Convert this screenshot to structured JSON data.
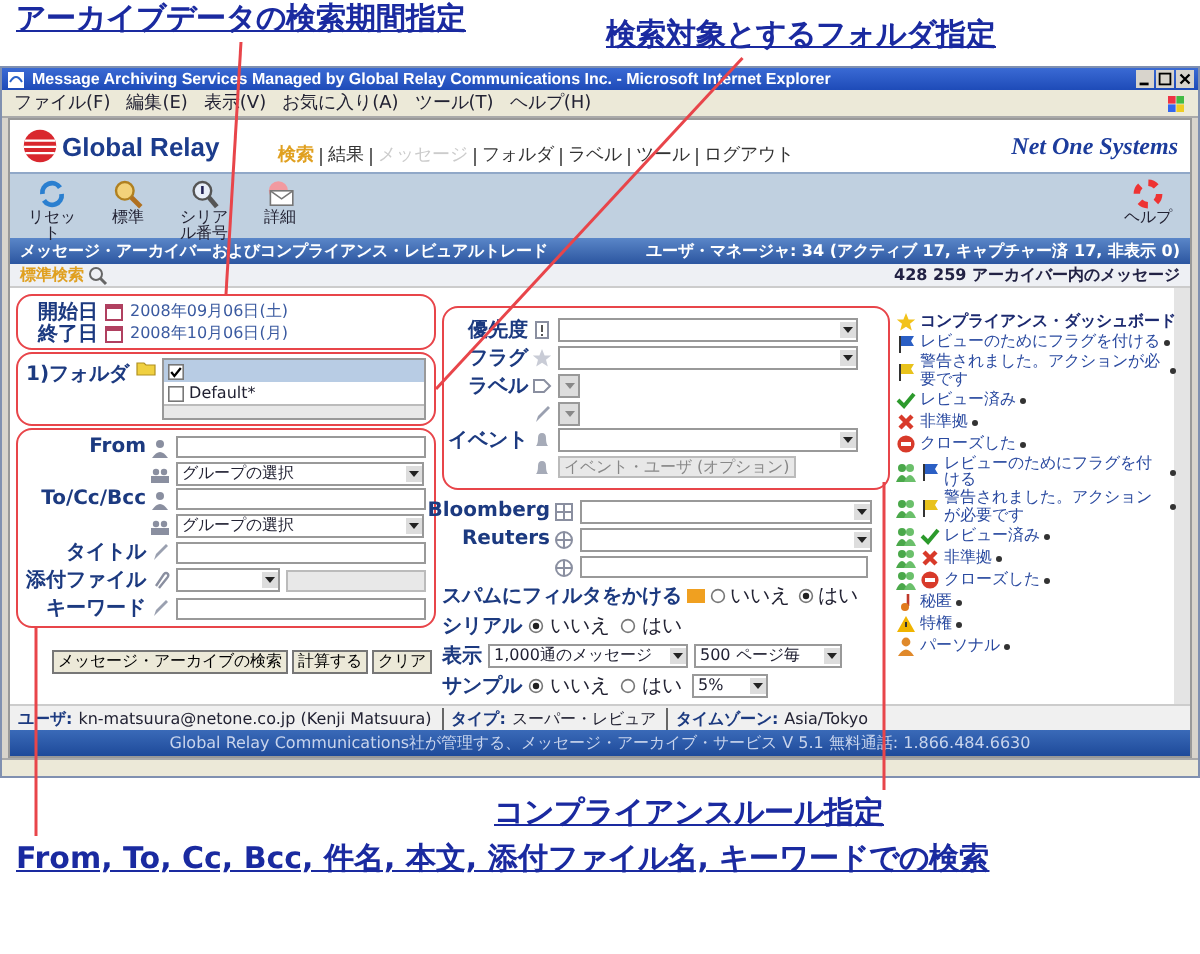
{
  "callouts_top": [
    "アーカイブデータの検索期間指定",
    "検索対象とするフォルダ指定"
  ],
  "window": {
    "title": "Message Archiving Services Managed by Global Relay Communications Inc. - Microsoft Internet Explorer",
    "menu": [
      "ファイル(F)",
      "編集(E)",
      "表示(V)",
      "お気に入り(A)",
      "ツール(T)",
      "ヘルプ(H)"
    ]
  },
  "header": {
    "logo": "Global Relay",
    "partner_logo": "Net One Systems",
    "nav": [
      {
        "label": "検索",
        "selected": true,
        "disabled": false
      },
      {
        "label": "結果",
        "selected": false,
        "disabled": false
      },
      {
        "label": "メッセージ",
        "selected": false,
        "disabled": true
      },
      {
        "label": "フォルダ",
        "selected": false,
        "disabled": false
      },
      {
        "label": "ラベル",
        "selected": false,
        "disabled": false
      },
      {
        "label": "ツール",
        "selected": false,
        "disabled": false
      },
      {
        "label": "ログアウト",
        "selected": false,
        "disabled": false
      }
    ]
  },
  "toolbar": [
    {
      "kind": "reset",
      "label": "リセット"
    },
    {
      "kind": "standard",
      "label": "標準"
    },
    {
      "kind": "serial",
      "label": "シリアル番号"
    },
    {
      "kind": "detail",
      "label": "詳細"
    }
  ],
  "help": "ヘルプ",
  "title_bar": {
    "left": "メッセージ・アーカイバーおよびコンプライアンス・レビュアルトレード",
    "right": "ユーザ・マネージャ: 34 (アクティブ 17, キャプチャー済 17, 非表示 0)"
  },
  "sub_bar": {
    "left": "標準検索",
    "right": "428 259 アーカイバー内のメッセージ"
  },
  "dates": [
    {
      "label": "開始日",
      "value": "2008年09月06日(土)"
    },
    {
      "label": "終了日",
      "value": "2008年10月06日(月)"
    }
  ],
  "folders": {
    "label": "1)フォルダ",
    "items": [
      {
        "checked": true,
        "selected": true
      },
      {
        "label": "Default*",
        "checked": false,
        "selected": false
      }
    ]
  },
  "search_fields": [
    {
      "kind": "text",
      "label": "From"
    },
    {
      "kind": "select",
      "value": "グループの選択"
    },
    {
      "kind": "text",
      "label": "To/Cc/Bcc"
    },
    {
      "kind": "select",
      "value": "グループの選択"
    },
    {
      "kind": "text",
      "label": "タイトル"
    },
    {
      "kind": "attachment",
      "label": "添付ファイル"
    },
    {
      "kind": "text",
      "label": "キーワード"
    }
  ],
  "buttons": [
    "メッセージ・アーカイブの検索",
    "計算する",
    "クリア"
  ],
  "rules": [
    {
      "kind": "select",
      "label": "優先度"
    },
    {
      "kind": "select",
      "label": "フラグ"
    },
    {
      "kind": "small",
      "label": "ラベル"
    },
    {
      "kind": "small"
    },
    {
      "kind": "select",
      "label": "イベント"
    },
    {
      "kind": "disabled",
      "placeholder": "イベント・ユーザ (オプション)"
    }
  ],
  "other_fields": [
    {
      "kind": "select",
      "label": "Bloomberg"
    },
    {
      "kind": "select",
      "label": "Reuters"
    },
    {
      "kind": "text"
    }
  ],
  "spam": {
    "label": "スパムにフィルタをかける",
    "options": [
      {
        "label": "いいえ",
        "selected": false
      },
      {
        "label": "はい",
        "selected": true
      }
    ]
  },
  "serial": {
    "label": "シリアル",
    "options": [
      {
        "label": "いいえ",
        "selected": true
      },
      {
        "label": "はい",
        "selected": false
      }
    ]
  },
  "display": {
    "label": "表示",
    "values": [
      "1,000通のメッセージ",
      "500 ページ毎"
    ]
  },
  "sample": {
    "label": "サンプル",
    "options": [
      {
        "label": "いいえ",
        "selected": true
      },
      {
        "label": "はい",
        "selected": false
      }
    ],
    "value": "5%"
  },
  "legend": {
    "title": "コンプライアンス・ダッシュボード",
    "items": [
      {
        "kind": "flag",
        "group": false,
        "label": "レビューのためにフラグを付ける"
      },
      {
        "kind": "alert",
        "group": false,
        "label": "警告されました。アクションが必要です"
      },
      {
        "kind": "check",
        "group": false,
        "label": "レビュー済み"
      },
      {
        "kind": "cross",
        "group": false,
        "label": "非準拠"
      },
      {
        "kind": "closed",
        "group": false,
        "label": "クローズした"
      },
      {
        "kind": "flag",
        "group": true,
        "label": "レビューのためにフラグを付ける"
      },
      {
        "kind": "alert",
        "group": true,
        "label": "警告されました。アクションが必要です"
      },
      {
        "kind": "check",
        "group": true,
        "label": "レビュー済み"
      },
      {
        "kind": "cross",
        "group": true,
        "label": "非準拠"
      },
      {
        "kind": "closed",
        "group": true,
        "label": "クローズした"
      },
      {
        "kind": "note",
        "group": false,
        "label": "秘匿"
      },
      {
        "kind": "warning",
        "group": false,
        "label": "特権"
      },
      {
        "kind": "person",
        "group": false,
        "label": "パーソナル"
      }
    ]
  },
  "user_bar": [
    {
      "label": "ユーザ:",
      "value": "kn-matsuura@netone.co.jp (Kenji Matsuura)"
    },
    {
      "label": "タイプ:",
      "value": "スーパー・レビュア"
    },
    {
      "label": "タイムゾーン:",
      "value": "Asia/Tokyo"
    }
  ],
  "footer": "Global Relay Communications社が管理する、メッセージ・アーカイブ・サービス V 5.1 無料通話: 1.866.484.6630",
  "callouts_bottom": [
    "コンプライアンスルール指定",
    "From, To, Cc, Bcc, 件名, 本文, 添付ファイル名, キーワードでの検索"
  ]
}
